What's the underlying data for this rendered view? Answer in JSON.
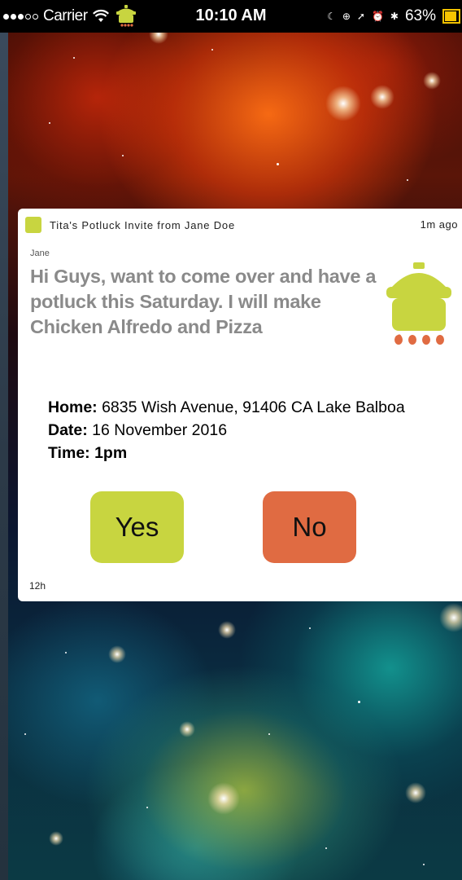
{
  "status_bar": {
    "signal_dots_filled": 3,
    "signal_dots_total": 5,
    "carrier": "Carrier",
    "time": "10:10 AM",
    "battery": "63%",
    "battery_color": "#f7c500"
  },
  "notification": {
    "title": "Tita's Potluck Invite from Jane Doe",
    "when": "1m ago",
    "sender": "Jane",
    "message": "Hi Guys, want to come over and have a potluck this Saturday. I will make Chicken Alfredo and Pizza",
    "details": {
      "home_label": "Home:",
      "home_value": " 6835 Wish Avenue, 91406 CA Lake Balboa",
      "date_label": "Date:",
      "date_value": " 16 November 2016",
      "time_label": "Time: 1pm"
    },
    "yes_label": "Yes",
    "no_label": "No",
    "stamp": "12h",
    "accent_color": "#c8d540",
    "decline_color": "#e06b42"
  }
}
